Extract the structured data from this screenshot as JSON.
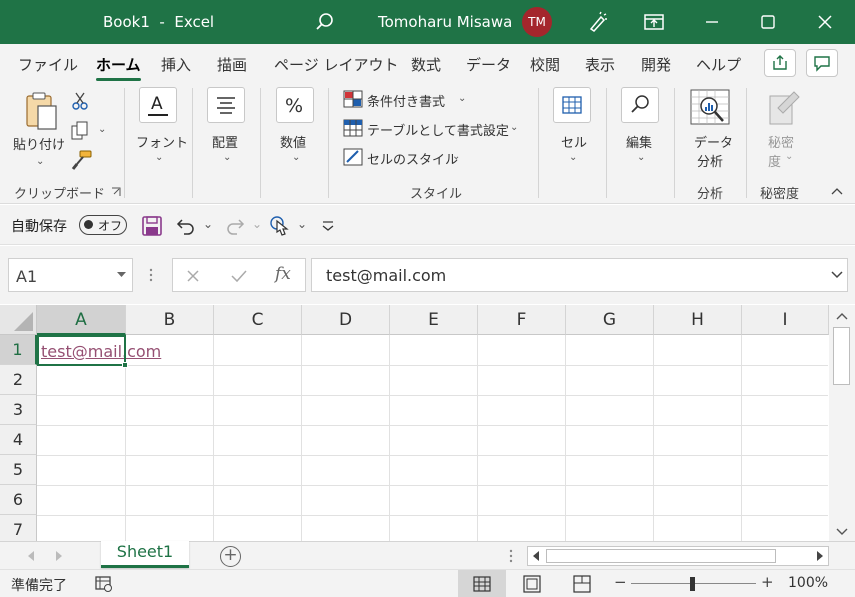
{
  "titlebar": {
    "title": "Book1  -  Excel",
    "user": "Tomoharu Misawa",
    "avatar_initials": "TM",
    "accent": "#1f7346"
  },
  "ribbon_tabs": [
    "ファイル",
    "ホーム",
    "挿入",
    "描画",
    "ページ レイアウト",
    "数式",
    "データ",
    "校閲",
    "表示",
    "開発",
    "ヘルプ"
  ],
  "ribbon": {
    "paste": "貼り付け",
    "clipboard_group": "クリップボード",
    "font": "フォント",
    "alignment": "配置",
    "number": "数値",
    "conditional_format": "条件付き書式",
    "format_as_table": "テーブルとして書式設定",
    "cell_styles": "セルのスタイル",
    "styles_group": "スタイル",
    "cells": "セル",
    "editing": "編集",
    "data_analysis_l1": "データ",
    "data_analysis_l2": "分析",
    "analysis_group": "分析",
    "sensitivity_l1": "秘密",
    "sensitivity_l2": "度",
    "sensitivity_group": "秘密度"
  },
  "qat": {
    "autosave_label": "自動保存",
    "autosave_state": "オフ"
  },
  "formula_bar": {
    "name_box": "A1",
    "fx": "fx",
    "value": "test@mail.com"
  },
  "grid": {
    "columns": [
      "A",
      "B",
      "C",
      "D",
      "E",
      "F",
      "G",
      "H",
      "I"
    ],
    "rows": [
      "1",
      "2",
      "3",
      "4",
      "5",
      "6",
      "7"
    ],
    "active_cell_value": "test@mail.com"
  },
  "sheets": {
    "tabs": [
      "Sheet1"
    ]
  },
  "status": {
    "ready": "準備完了",
    "zoom": "100%"
  }
}
